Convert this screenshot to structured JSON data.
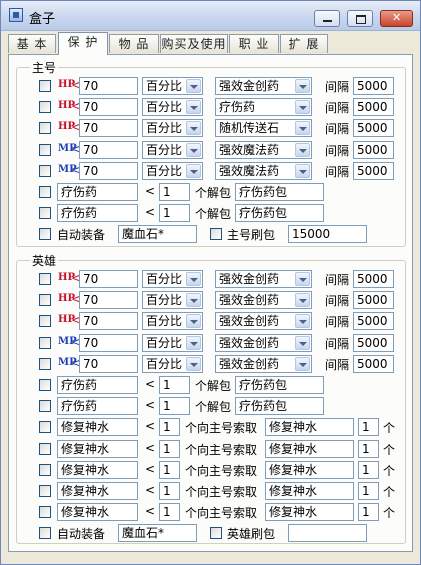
{
  "window": {
    "title": "盒子"
  },
  "tabs": [
    {
      "label": "基 本",
      "active": false
    },
    {
      "label": "保 护",
      "active": true
    },
    {
      "label": "物 品",
      "active": false
    },
    {
      "label": "购买及使用",
      "active": false
    },
    {
      "label": "职 业",
      "active": false
    },
    {
      "label": "扩 展",
      "active": false
    }
  ],
  "main": {
    "legend": "主号",
    "stat_rows": [
      {
        "tag": "HP",
        "cmp": "<",
        "value": "70",
        "mode": "百分比",
        "item": "强效金创药",
        "interval_label": "间隔",
        "interval": "5000"
      },
      {
        "tag": "HP",
        "cmp": "<",
        "value": "70",
        "mode": "百分比",
        "item": "疗伤药",
        "interval_label": "间隔",
        "interval": "5000"
      },
      {
        "tag": "HP",
        "cmp": "<",
        "value": "70",
        "mode": "百分比",
        "item": "随机传送石",
        "interval_label": "间隔",
        "interval": "5000"
      },
      {
        "tag": "MP",
        "cmp": "<",
        "value": "70",
        "mode": "百分比",
        "item": "强效魔法药",
        "interval_label": "间隔",
        "interval": "5000"
      },
      {
        "tag": "MP",
        "cmp": "<",
        "value": "70",
        "mode": "百分比",
        "item": "强效魔法药",
        "interval_label": "间隔",
        "interval": "5000"
      }
    ],
    "unpack_rows": [
      {
        "item": "疗伤药",
        "cmp": "<",
        "count": "1",
        "label": "个解包",
        "pack": "疗伤药包"
      },
      {
        "item": "疗伤药",
        "cmp": "<",
        "count": "1",
        "label": "个解包",
        "pack": "疗伤药包"
      }
    ],
    "auto_equip_label": "自动装备",
    "auto_equip_value": "魔血石*",
    "refresh_label": "主号刷包",
    "refresh_value": "15000"
  },
  "hero": {
    "legend": "英雄",
    "stat_rows": [
      {
        "tag": "HP",
        "cmp": "<",
        "value": "70",
        "mode": "百分比",
        "item": "强效金创药",
        "interval_label": "间隔",
        "interval": "5000"
      },
      {
        "tag": "HP",
        "cmp": "<",
        "value": "70",
        "mode": "百分比",
        "item": "强效金创药",
        "interval_label": "间隔",
        "interval": "5000"
      },
      {
        "tag": "HP",
        "cmp": "<",
        "value": "70",
        "mode": "百分比",
        "item": "强效金创药",
        "interval_label": "间隔",
        "interval": "5000"
      },
      {
        "tag": "MP",
        "cmp": "<",
        "value": "70",
        "mode": "百分比",
        "item": "强效金创药",
        "interval_label": "间隔",
        "interval": "5000"
      },
      {
        "tag": "MP",
        "cmp": "<",
        "value": "70",
        "mode": "百分比",
        "item": "强效金创药",
        "interval_label": "间隔",
        "interval": "5000"
      }
    ],
    "unpack_rows": [
      {
        "item": "疗伤药",
        "cmp": "<",
        "count": "1",
        "label": "个解包",
        "pack": "疗伤药包"
      },
      {
        "item": "疗伤药",
        "cmp": "<",
        "count": "1",
        "label": "个解包",
        "pack": "疗伤药包"
      }
    ],
    "request_rows": [
      {
        "item": "修复神水",
        "cmp": "<",
        "count": "1",
        "label": "个向主号索取",
        "req_item": "修复神水",
        "req_count": "1",
        "unit": "个"
      },
      {
        "item": "修复神水",
        "cmp": "<",
        "count": "1",
        "label": "个向主号索取",
        "req_item": "修复神水",
        "req_count": "1",
        "unit": "个"
      },
      {
        "item": "修复神水",
        "cmp": "<",
        "count": "1",
        "label": "个向主号索取",
        "req_item": "修复神水",
        "req_count": "1",
        "unit": "个"
      },
      {
        "item": "修复神水",
        "cmp": "<",
        "count": "1",
        "label": "个向主号索取",
        "req_item": "修复神水",
        "req_count": "1",
        "unit": "个"
      },
      {
        "item": "修复神水",
        "cmp": "<",
        "count": "1",
        "label": "个向主号索取",
        "req_item": "修复神水",
        "req_count": "1",
        "unit": "个"
      }
    ],
    "auto_equip_label": "自动装备",
    "auto_equip_value": "魔血石*",
    "refresh_label": "英雄刷包",
    "refresh_value": ""
  }
}
